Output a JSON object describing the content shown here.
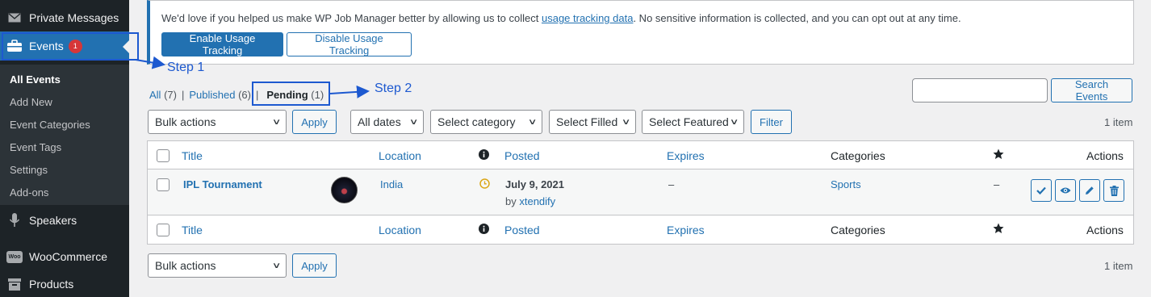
{
  "sidebar": {
    "private_messages": "Private Messages",
    "events": "Events",
    "events_badge": "1",
    "submenu": [
      "All Events",
      "Add New",
      "Event Categories",
      "Event Tags",
      "Settings",
      "Add-ons"
    ],
    "speakers": "Speakers",
    "woocommerce": "WooCommerce",
    "woo_icon_text": "Woo",
    "products": "Products"
  },
  "notice": {
    "text_before": "We'd love if you helped us make WP Job Manager better by allowing us to collect ",
    "link": "usage tracking data",
    "text_after": ". No sensitive information is collected, and you can opt out at any time.",
    "enable": "Enable Usage Tracking",
    "disable": "Disable Usage Tracking"
  },
  "views": {
    "all": "All",
    "all_count": "(7)",
    "published": "Published",
    "published_count": "(6)",
    "pending": "Pending",
    "pending_count": "(1)",
    "sep": "|"
  },
  "search": {
    "button": "Search Events",
    "value": ""
  },
  "filters": {
    "bulk_actions": "Bulk actions",
    "apply": "Apply",
    "dates": "All dates",
    "category": "Select category",
    "filled": "Select Filled",
    "featured": "Select Featured",
    "filter": "Filter",
    "items_count": "1 item"
  },
  "table": {
    "columns": {
      "title": "Title",
      "location": "Location",
      "posted": "Posted",
      "expires": "Expires",
      "categories": "Categories",
      "actions": "Actions"
    },
    "row": {
      "title": "IPL Tournament",
      "location": "India",
      "posted_date": "July 9, 2021",
      "posted_by_prefix": "by",
      "posted_by": "xtendify",
      "expires": "–",
      "category": "Sports",
      "featured": "–"
    }
  },
  "annotations": {
    "step1": "Step 1",
    "step2": "Step 2"
  },
  "colors": {
    "accent": "#2271b1",
    "sidebar": "#1d2327",
    "annotation": "#1d59d0",
    "badge": "#d63638"
  }
}
